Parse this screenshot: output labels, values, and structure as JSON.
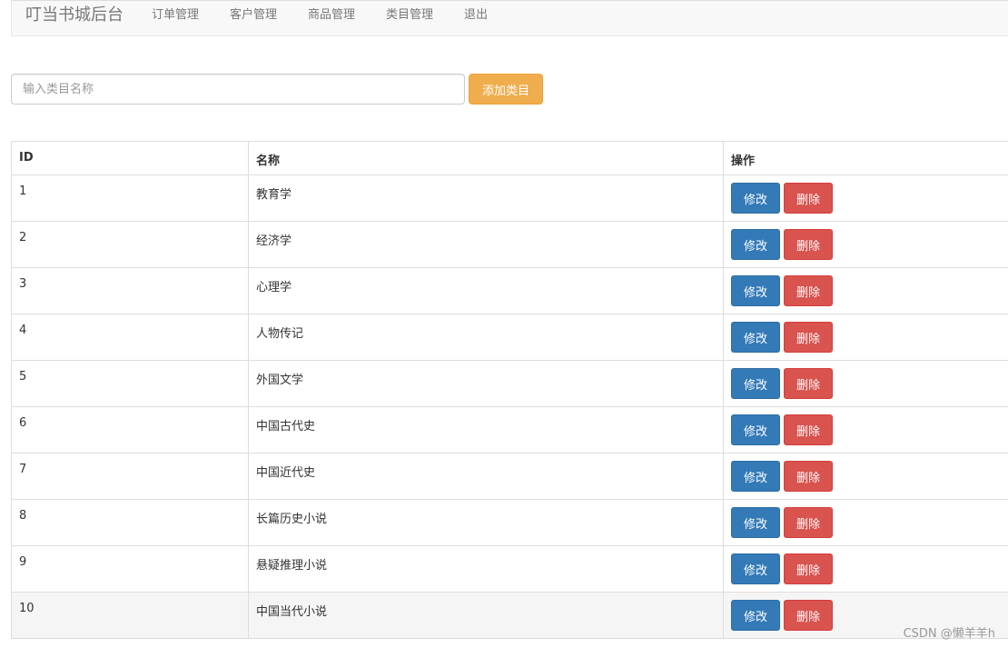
{
  "navbar": {
    "brand": "叮当书城后台",
    "items": [
      "订单管理",
      "客户管理",
      "商品管理",
      "类目管理",
      "退出"
    ]
  },
  "search": {
    "placeholder": "输入类目名称",
    "add_label": "添加类目"
  },
  "table": {
    "headers": [
      "ID",
      "名称",
      "操作"
    ],
    "edit_label": "修改",
    "delete_label": "删除",
    "rows": [
      {
        "id": "1",
        "name": "教育学"
      },
      {
        "id": "2",
        "name": "经济学"
      },
      {
        "id": "3",
        "name": "心理学"
      },
      {
        "id": "4",
        "name": "人物传记"
      },
      {
        "id": "5",
        "name": "外国文学"
      },
      {
        "id": "6",
        "name": "中国古代史"
      },
      {
        "id": "7",
        "name": "中国近代史"
      },
      {
        "id": "8",
        "name": "长篇历史小说"
      },
      {
        "id": "9",
        "name": "悬疑推理小说"
      },
      {
        "id": "10",
        "name": "中国当代小说"
      }
    ]
  },
  "watermark": "CSDN @懒羊羊h",
  "colors": {
    "add_button": "#f0ad4e",
    "edit_button": "#337ab7",
    "delete_button": "#d9534f"
  }
}
